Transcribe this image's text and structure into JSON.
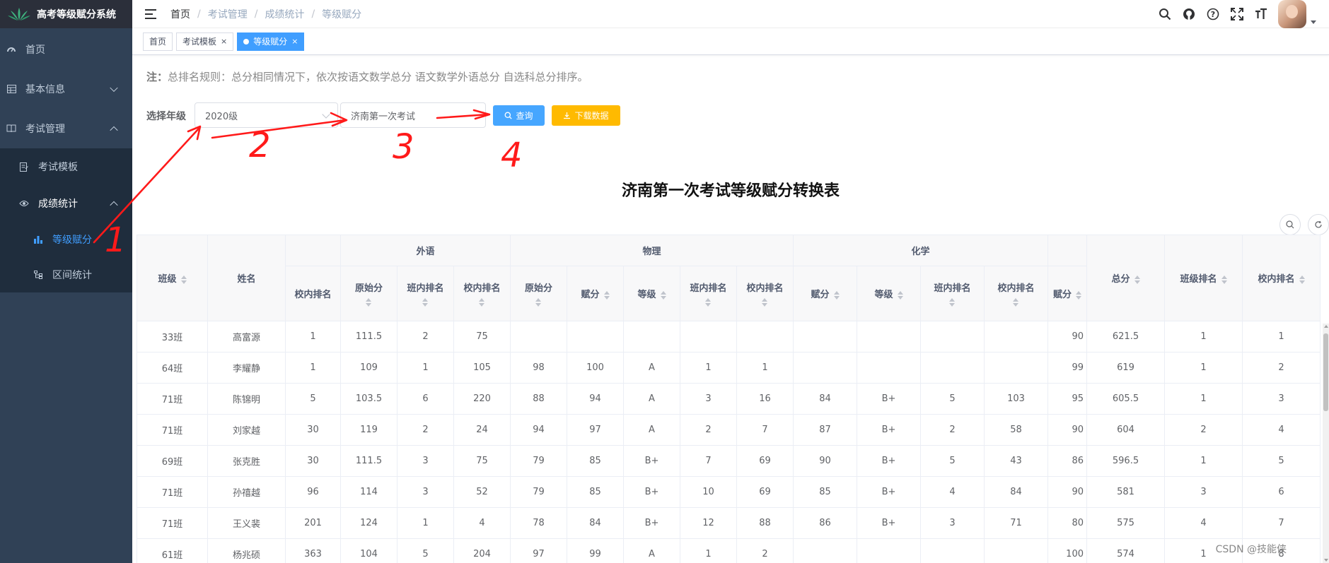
{
  "app": {
    "title": "高考等级赋分系统"
  },
  "sidebar": {
    "items": [
      {
        "label": "首页",
        "icon": "dashboard-icon"
      },
      {
        "label": "基本信息",
        "icon": "table-icon"
      },
      {
        "label": "考试管理",
        "icon": "book-icon"
      }
    ],
    "exam_sub": [
      {
        "label": "考试模板",
        "icon": "form-icon"
      },
      {
        "label": "成绩统计",
        "icon": "eye-icon"
      }
    ],
    "stats_sub": [
      {
        "label": "等级赋分",
        "icon": "bar-chart-icon"
      },
      {
        "label": "区间统计",
        "icon": "tree-icon"
      }
    ]
  },
  "breadcrumb": [
    "首页",
    "考试管理",
    "成绩统计",
    "等级赋分"
  ],
  "tags": [
    {
      "label": "首页"
    },
    {
      "label": "考试模板"
    },
    {
      "label": "等级赋分"
    }
  ],
  "note": {
    "prefix": "注：",
    "text": "总排名规则：总分相同情况下，依次按语文数学总分 语文数学外语总分 自选科总分排序。"
  },
  "filter": {
    "label": "选择年级",
    "grade": "2020级",
    "exam": "济南第一次考试",
    "query_label": "查询",
    "download_label": "下载数据"
  },
  "table": {
    "title": "济南第一次考试等级赋分转换表",
    "groups": [
      "外语",
      "物理",
      "化学"
    ],
    "cols": {
      "class": "班级",
      "name": "姓名",
      "pre_rank": "校内排名",
      "fl_raw": "原始分",
      "fl_class_rank": "班内排名",
      "fl_school_rank": "校内排名",
      "ph_raw": "原始分",
      "ph_score": "赋分",
      "ph_grade": "等级",
      "ph_class_rank": "班内排名",
      "ph_school_rank": "校内排名",
      "ch_score": "赋分",
      "ch_grade": "等级",
      "ch_class_rank": "班内排名",
      "ch_school_rank": "校内排名",
      "next_score": "赋分",
      "total": "总分",
      "class_rank": "班级排名",
      "school_rank": "校内排名"
    },
    "rows": [
      [
        "33班",
        "高富源",
        "1",
        "111.5",
        "2",
        "75",
        "",
        "",
        "",
        "",
        "",
        "",
        "",
        "",
        "",
        "90",
        "621.5",
        "1",
        "1"
      ],
      [
        "64班",
        "李耀静",
        "1",
        "109",
        "1",
        "105",
        "98",
        "100",
        "A",
        "1",
        "1",
        "",
        "",
        "",
        "",
        "99",
        "619",
        "1",
        "2"
      ],
      [
        "71班",
        "陈锦明",
        "5",
        "103.5",
        "6",
        "220",
        "88",
        "94",
        "A",
        "3",
        "16",
        "84",
        "B+",
        "5",
        "103",
        "95",
        "605.5",
        "1",
        "3"
      ],
      [
        "71班",
        "刘家越",
        "30",
        "119",
        "2",
        "24",
        "94",
        "97",
        "A",
        "2",
        "7",
        "87",
        "B+",
        "2",
        "58",
        "90",
        "604",
        "2",
        "4"
      ],
      [
        "69班",
        "张克胜",
        "30",
        "111.5",
        "3",
        "75",
        "79",
        "85",
        "B+",
        "7",
        "69",
        "90",
        "B+",
        "5",
        "43",
        "86",
        "596.5",
        "1",
        "5"
      ],
      [
        "71班",
        "孙禧越",
        "96",
        "114",
        "3",
        "52",
        "79",
        "85",
        "B+",
        "10",
        "69",
        "85",
        "B+",
        "4",
        "84",
        "90",
        "581",
        "3",
        "6"
      ],
      [
        "71班",
        "王义裴",
        "201",
        "124",
        "1",
        "4",
        "78",
        "84",
        "B+",
        "12",
        "88",
        "86",
        "B+",
        "3",
        "71",
        "80",
        "575",
        "4",
        "7"
      ],
      [
        "61班",
        "杨兆硕",
        "363",
        "104",
        "5",
        "204",
        "97",
        "99",
        "A",
        "1",
        "2",
        "",
        "",
        "",
        "",
        "100",
        "574",
        "1",
        "8"
      ]
    ]
  },
  "annotations": [
    "1",
    "2",
    "3",
    "4"
  ],
  "watermark": "CSDN @技能侠",
  "colors": {
    "sidebar_bg": "#304156",
    "accent": "#409eff",
    "download": "#ffba00",
    "annotation": "#ff1a1a"
  }
}
